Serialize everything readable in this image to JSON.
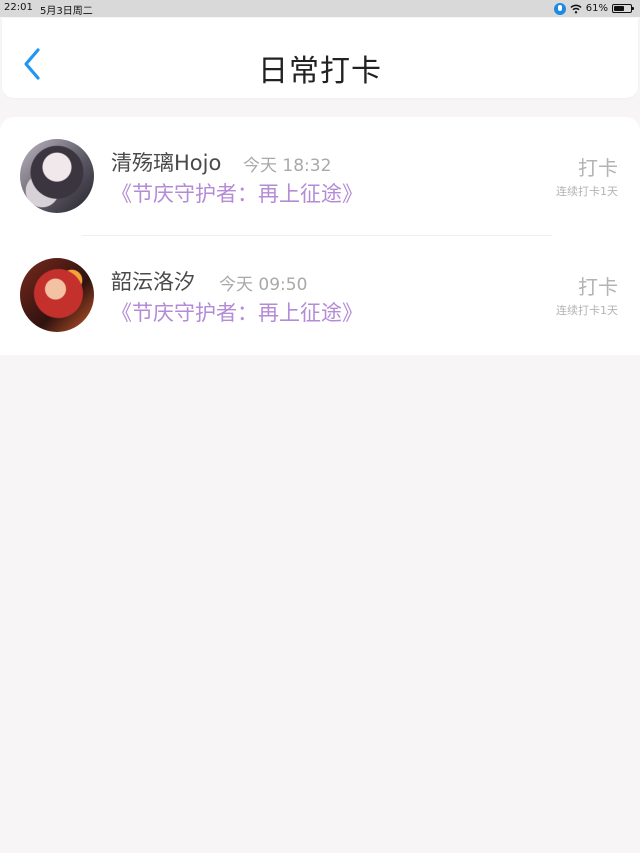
{
  "status_bar": {
    "time": "22:01",
    "date": "5月3日周二",
    "battery": "61%"
  },
  "header": {
    "title": "日常打卡"
  },
  "items": [
    {
      "name": "清殇璃Hojo",
      "time": "今天 18:32",
      "activity": "《节庆守护者：再上征途》",
      "checkin": "打卡",
      "streak": "连续打卡1天"
    },
    {
      "name": "韶沄洛汐",
      "time": "今天 09:50",
      "activity": "《节庆守护者：再上征途》",
      "checkin": "打卡",
      "streak": "连续打卡1天"
    }
  ],
  "colors": {
    "accent": "#2196f3",
    "activity": "#b48bd6",
    "muted": "#b3b3b3"
  }
}
